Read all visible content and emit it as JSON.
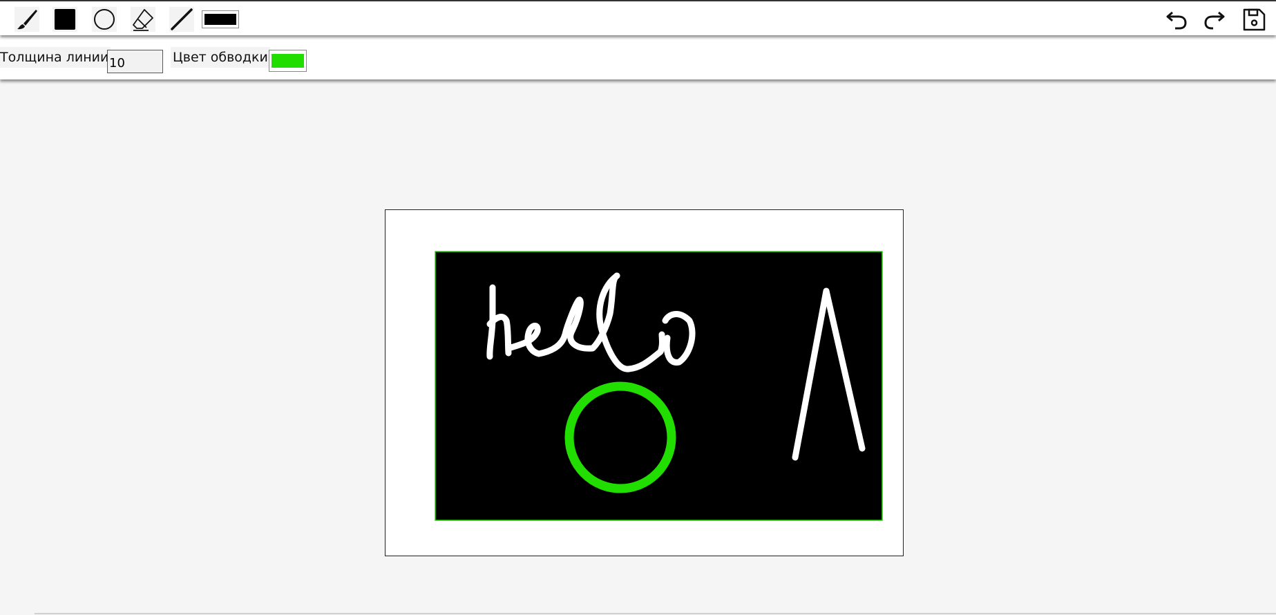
{
  "toolbar": {
    "tools": [
      {
        "name": "brush-tool",
        "icon": "brush-icon"
      },
      {
        "name": "rectangle-tool",
        "icon": "filled-square-icon"
      },
      {
        "name": "circle-tool",
        "icon": "circle-icon"
      },
      {
        "name": "eraser-tool",
        "icon": "eraser-icon"
      },
      {
        "name": "line-tool",
        "icon": "line-icon"
      }
    ],
    "fill_color": "#000000",
    "actions": [
      {
        "name": "undo-button",
        "icon": "undo-icon"
      },
      {
        "name": "redo-button",
        "icon": "redo-icon"
      },
      {
        "name": "save-button",
        "icon": "save-icon"
      }
    ]
  },
  "options": {
    "line_width_label": "Толщина линии",
    "line_width_value": "10",
    "stroke_color_label": "Цвет обводки",
    "stroke_color": "#22dd00"
  },
  "canvas": {
    "background": "#ffffff",
    "shapes": [
      {
        "type": "rectangle",
        "fill": "#000000",
        "stroke": "#22dd00"
      },
      {
        "type": "freehand-text",
        "text": "hello",
        "color": "#ffffff"
      },
      {
        "type": "circle",
        "stroke": "#22dd00"
      },
      {
        "type": "freehand",
        "color": "#ffffff"
      }
    ]
  }
}
